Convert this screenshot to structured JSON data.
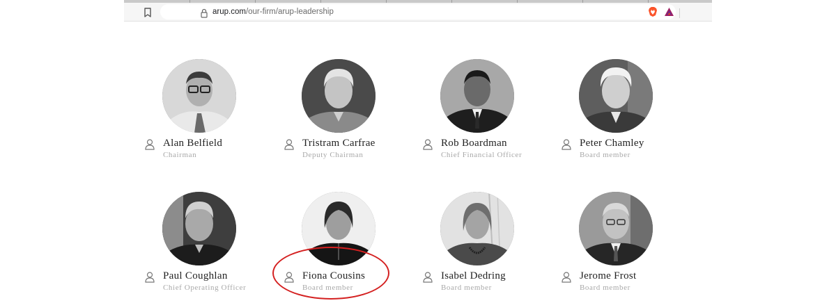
{
  "browser": {
    "url_host": "arup.com",
    "url_path": "/our-firm/arup-leadership"
  },
  "leaders": [
    {
      "name": "Alan Belfield",
      "role": "Chairman"
    },
    {
      "name": "Tristram Carfrae",
      "role": "Deputy Chairman"
    },
    {
      "name": "Rob Boardman",
      "role": "Chief Financial Officer"
    },
    {
      "name": "Peter Chamley",
      "role": "Board member"
    },
    {
      "name": "Paul Coughlan",
      "role": "Chief Operating Officer"
    },
    {
      "name": "Fiona Cousins",
      "role": "Board member"
    },
    {
      "name": "Isabel Dedring",
      "role": "Board member"
    },
    {
      "name": "Jerome Frost",
      "role": "Board member"
    }
  ],
  "annotation": {
    "color": "#d42020",
    "highlighted_leader": "Fiona Cousins"
  }
}
